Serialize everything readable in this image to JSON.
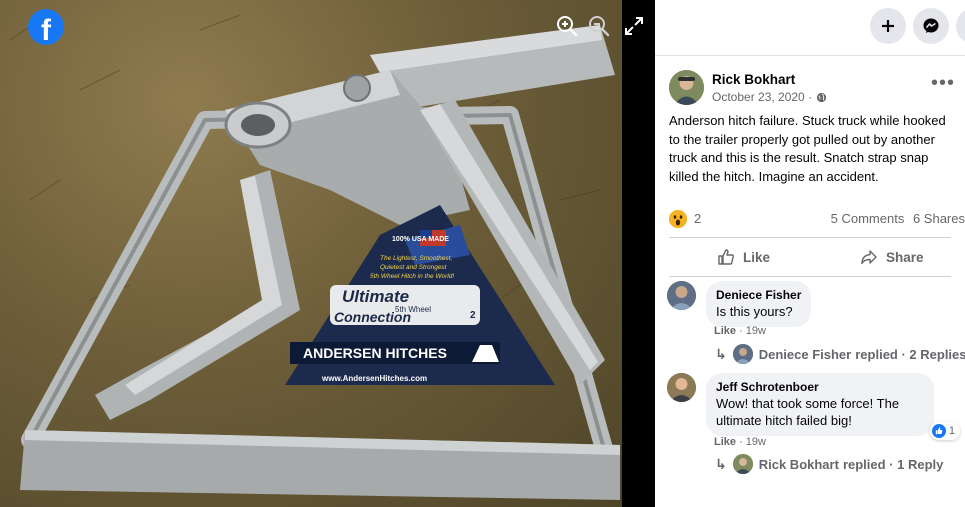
{
  "viewer": {
    "logo_letter": "f",
    "icons": [
      "zoom-in-icon",
      "zoom-out-icon",
      "expand-icon"
    ],
    "photo": {
      "sign_lines": [
        "100% USA MADE",
        "The Lightest, Smoothest,",
        "Quietest and Strongest",
        "5th Wheel Hitch in the World!",
        "Ultimate",
        "5th Wheel",
        "Connection",
        "2",
        "ANDERSEN HITCHES",
        "www.AndersenHitches.com"
      ]
    }
  },
  "panel": {
    "actions": [
      "add-icon",
      "messenger-icon"
    ],
    "post": {
      "author": "Rick Bokhart",
      "date": "October 23, 2020 ·",
      "text": "Anderson hitch failure. Stuck truck while hooked to the trailer properly got pulled out by another truck and this is the result. Snatch strap snap killed the hitch. Imagine an accident.",
      "reaction_count": "2",
      "comments_count": "5 Comments",
      "shares_count": "6 Shares",
      "like_label": "Like",
      "share_label": "Share"
    },
    "comments": [
      {
        "author": "Deniece Fisher",
        "text": "Is this yours?",
        "like_label": "Like",
        "time": "· 19w",
        "replies_author": "Deniece Fisher",
        "replies_text": "replied · 2 Replies"
      },
      {
        "author": "Jeff Schrotenboer",
        "text": "Wow! that took some force! The ultimate hitch failed big!",
        "like_label": "Like",
        "time": "· 19w",
        "like_count": "1",
        "replies_author": "Rick Bokhart",
        "replies_text": "replied · 1 Reply"
      }
    ]
  },
  "colors": {
    "facebook_blue": "#1877f2",
    "secondary_text": "#65676b",
    "bubble_bg": "#f0f2f5"
  }
}
